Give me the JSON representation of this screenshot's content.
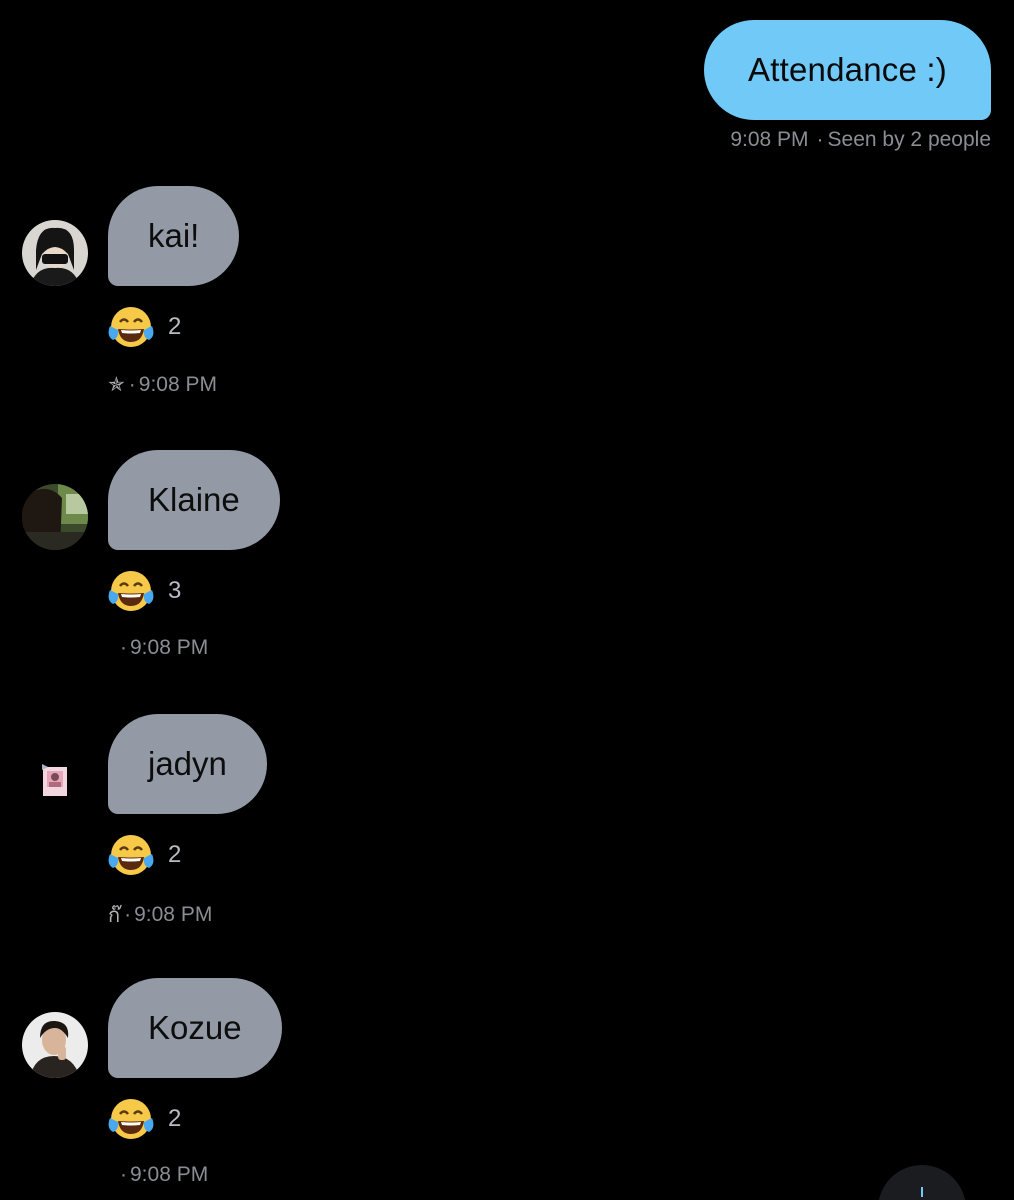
{
  "outgoing": {
    "text": "Attendance :)",
    "time": "9:08 PM",
    "separator": "·",
    "seen": "Seen by 2 people"
  },
  "messages": [
    {
      "sender_avatar": "avatar-photo",
      "text": "kai!",
      "reaction_emoji": "😂",
      "reaction_count": "2",
      "nick_glyph": "✯",
      "separator": "·",
      "time": "9:08 PM"
    },
    {
      "sender_avatar": "avatar-photo",
      "text": "Klaine",
      "reaction_emoji": "😂",
      "reaction_count": "3",
      "nick_glyph": "",
      "separator": "·",
      "time": "9:08 PM"
    },
    {
      "sender_avatar": "avatar-photo",
      "text": "jadyn",
      "reaction_emoji": "😂",
      "reaction_count": "2",
      "nick_glyph": "ก๊",
      "separator": "·",
      "time": "9:08 PM"
    },
    {
      "sender_avatar": "avatar-photo",
      "text": "Kozue",
      "reaction_emoji": "😂",
      "reaction_count": "2",
      "nick_glyph": "",
      "separator": "·",
      "time": "9:08 PM"
    }
  ],
  "colors": {
    "background": "#000000",
    "outgoing_bubble": "#71c9f8",
    "incoming_bubble": "#939aa6",
    "meta_text": "#8a8d93"
  },
  "fab_icon": "compose-icon"
}
